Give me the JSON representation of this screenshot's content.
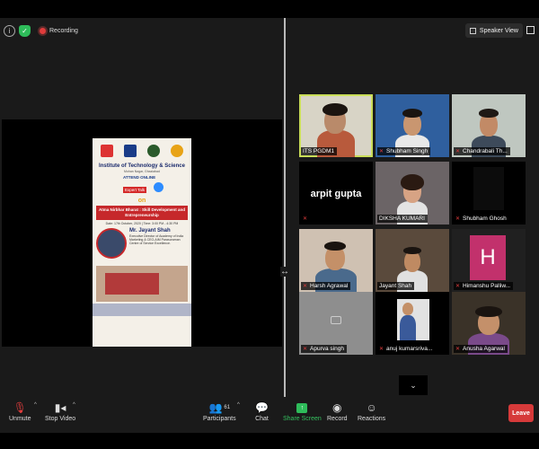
{
  "recording_label": "Recording",
  "speaker_view_label": "Speaker View",
  "poster": {
    "institute": "Institute of Technology & Science",
    "location": "Mohan Nagar, Ghaziabad",
    "attend_online": "ATTEND ONLINE",
    "expert_talk": "Expert Talk",
    "on": "on",
    "topic": "Atma Nirbhar Bharat : Skill Development and Entrepreneurship",
    "date": "Date: 17th October, 2020 | Time: 3:00 PM - 4:30 PM",
    "speaker_name": "Mr. Jayant Shah",
    "speaker_desc": "Executive Director of Academy of India Marketing & CEO-AIM Parasuraman Centre of Service Excellence."
  },
  "participants": [
    {
      "name": "ITS PGDM1",
      "muted": false,
      "type": "video"
    },
    {
      "name": "Shubham Singh",
      "muted": true,
      "type": "video"
    },
    {
      "name": "Chandrabali Th...",
      "muted": true,
      "type": "video"
    },
    {
      "name": "DIKSHA KUMARI",
      "muted": true,
      "type": "video",
      "display_name": "arpit gupta"
    },
    {
      "name": "DIKSHA KUMARI",
      "muted": true,
      "type": "video"
    },
    {
      "name": "Shubham Ghosh",
      "muted": true,
      "type": "video"
    },
    {
      "name": "Harsh Agrawal",
      "muted": true,
      "type": "video"
    },
    {
      "name": "Jayant Shah",
      "muted": false,
      "type": "video"
    },
    {
      "name": "Himanshu Palliw...",
      "muted": true,
      "type": "avatar",
      "initial": "H"
    },
    {
      "name": "Apurva singh",
      "muted": true,
      "type": "camera-off"
    },
    {
      "name": "anuj kumarsriva...",
      "muted": true,
      "type": "video"
    },
    {
      "name": "Anusha Agarwal",
      "muted": true,
      "type": "video"
    }
  ],
  "toolbar": {
    "unmute": "Unmute",
    "stop_video": "Stop Video",
    "participants": "Participants",
    "participants_count": "61",
    "chat": "Chat",
    "share_screen": "Share Screen",
    "record": "Record",
    "reactions": "Reactions",
    "leave": "Leave"
  },
  "colors": {
    "active_speaker": "#c9dd58",
    "share_green": "#35c15f",
    "leave_red": "#d63a3a",
    "avatar_magenta": "#c2316c"
  }
}
